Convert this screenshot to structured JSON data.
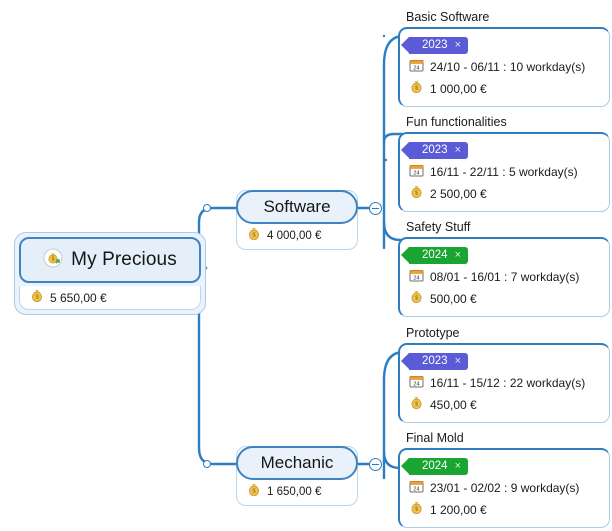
{
  "root": {
    "title": "My Precious",
    "icon": "money-bag-income-icon",
    "cost": "5 650,00 €",
    "cost_icon": "money-bag-icon"
  },
  "branches": [
    {
      "id": "software",
      "title": "Software",
      "cost": "4 000,00 €",
      "cost_icon": "money-bag-icon",
      "collapse_control": "minus-circle-icon",
      "leaves": [
        {
          "label": "Basic Software",
          "tag": {
            "text": "2023",
            "color": "#5b5bd6",
            "close": "×"
          },
          "schedule": "24/10 - 06/11 : 10 workday(s)",
          "schedule_icon": "calendar-24-icon",
          "cost": "1 000,00 €",
          "cost_icon": "money-bag-icon"
        },
        {
          "label": "Fun functionalities",
          "tag": {
            "text": "2023",
            "color": "#5b5bd6",
            "close": "×"
          },
          "schedule": "16/11 - 22/11 : 5 workday(s)",
          "schedule_icon": "calendar-24-icon",
          "cost": "2 500,00 €",
          "cost_icon": "money-bag-icon"
        },
        {
          "label": "Safety Stuff",
          "tag": {
            "text": "2024",
            "color": "#1aa431",
            "close": "×"
          },
          "schedule": "08/01 - 16/01 : 7 workday(s)",
          "schedule_icon": "calendar-24-icon",
          "cost": "500,00 €",
          "cost_icon": "money-bag-icon"
        }
      ]
    },
    {
      "id": "mechanic",
      "title": "Mechanic",
      "cost": "1 650,00 €",
      "cost_icon": "money-bag-icon",
      "collapse_control": "minus-circle-icon",
      "leaves": [
        {
          "label": "Prototype",
          "tag": {
            "text": "2023",
            "color": "#5b5bd6",
            "close": "×"
          },
          "schedule": "16/11 - 15/12 : 22 workday(s)",
          "schedule_icon": "calendar-24-icon",
          "cost": "450,00 €",
          "cost_icon": "money-bag-icon"
        },
        {
          "label": "Final Mold",
          "tag": {
            "text": "2024",
            "color": "#1aa431",
            "close": "×"
          },
          "schedule": "23/01 - 02/02 : 9 workday(s)",
          "schedule_icon": "calendar-24-icon",
          "cost": "1 200,00 €",
          "cost_icon": "money-bag-icon"
        }
      ]
    }
  ],
  "theme": {
    "link_color": "#2d7dc0",
    "node_border": "#3f83c4",
    "node_fill": "#e7f0fa",
    "tag_2023": "#5b5bd6",
    "tag_2024": "#1aa431"
  }
}
